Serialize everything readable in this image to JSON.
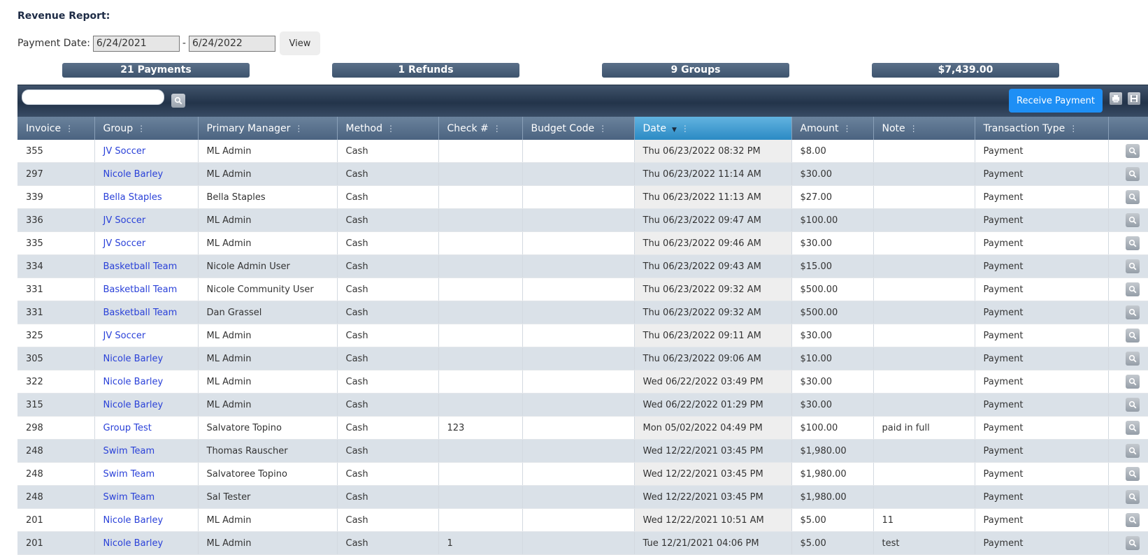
{
  "header": {
    "title": "Revenue Report:",
    "payment_date_label": "Payment Date:",
    "start_date": "6/24/2021",
    "end_date": "6/24/2022",
    "separator": "-",
    "view_label": "View"
  },
  "summary": [
    {
      "label": "21 Payments"
    },
    {
      "label": "1 Refunds"
    },
    {
      "label": "9 Groups"
    },
    {
      "label": "$7,439.00"
    }
  ],
  "toolbar": {
    "search_value": "",
    "receive_payment_label": "Receive Payment",
    "icons": [
      "search-icon",
      "print-icon",
      "save-icon"
    ]
  },
  "table": {
    "sorted_column": "Date",
    "sort_direction": "descending",
    "columns": [
      "Invoice",
      "Group",
      "Primary Manager",
      "Method",
      "Check #",
      "Budget Code",
      "Date",
      "Amount",
      "Note",
      "Transaction Type"
    ],
    "rows": [
      {
        "invoice": "355",
        "group": "JV Soccer",
        "manager": "ML Admin",
        "method": "Cash",
        "check": "",
        "budget": "",
        "date": "Thu 06/23/2022 08:32 PM",
        "amount": "$8.00",
        "note": "",
        "type": "Payment"
      },
      {
        "invoice": "297",
        "group": "Nicole Barley",
        "manager": "ML Admin",
        "method": "Cash",
        "check": "",
        "budget": "",
        "date": "Thu 06/23/2022 11:14 AM",
        "amount": "$30.00",
        "note": "",
        "type": "Payment"
      },
      {
        "invoice": "339",
        "group": "Bella Staples",
        "manager": "Bella Staples",
        "method": "Cash",
        "check": "",
        "budget": "",
        "date": "Thu 06/23/2022 11:13 AM",
        "amount": "$27.00",
        "note": "",
        "type": "Payment"
      },
      {
        "invoice": "336",
        "group": "JV Soccer",
        "manager": "ML Admin",
        "method": "Cash",
        "check": "",
        "budget": "",
        "date": "Thu 06/23/2022 09:47 AM",
        "amount": "$100.00",
        "note": "",
        "type": "Payment"
      },
      {
        "invoice": "335",
        "group": "JV Soccer",
        "manager": "ML Admin",
        "method": "Cash",
        "check": "",
        "budget": "",
        "date": "Thu 06/23/2022 09:46 AM",
        "amount": "$30.00",
        "note": "",
        "type": "Payment"
      },
      {
        "invoice": "334",
        "group": "Basketball Team",
        "manager": "Nicole Admin User",
        "method": "Cash",
        "check": "",
        "budget": "",
        "date": "Thu 06/23/2022 09:43 AM",
        "amount": "$15.00",
        "note": "",
        "type": "Payment"
      },
      {
        "invoice": "331",
        "group": "Basketball Team",
        "manager": "Nicole Community User",
        "method": "Cash",
        "check": "",
        "budget": "",
        "date": "Thu 06/23/2022 09:32 AM",
        "amount": "$500.00",
        "note": "",
        "type": "Payment"
      },
      {
        "invoice": "331",
        "group": "Basketball Team",
        "manager": "Dan Grassel",
        "method": "Cash",
        "check": "",
        "budget": "",
        "date": "Thu 06/23/2022 09:32 AM",
        "amount": "$500.00",
        "note": "",
        "type": "Payment"
      },
      {
        "invoice": "325",
        "group": "JV Soccer",
        "manager": "ML Admin",
        "method": "Cash",
        "check": "",
        "budget": "",
        "date": "Thu 06/23/2022 09:11 AM",
        "amount": "$30.00",
        "note": "",
        "type": "Payment"
      },
      {
        "invoice": "305",
        "group": "Nicole Barley",
        "manager": "ML Admin",
        "method": "Cash",
        "check": "",
        "budget": "",
        "date": "Thu 06/23/2022 09:06 AM",
        "amount": "$10.00",
        "note": "",
        "type": "Payment"
      },
      {
        "invoice": "322",
        "group": "Nicole Barley",
        "manager": "ML Admin",
        "method": "Cash",
        "check": "",
        "budget": "",
        "date": "Wed 06/22/2022 03:49 PM",
        "amount": "$30.00",
        "note": "",
        "type": "Payment"
      },
      {
        "invoice": "315",
        "group": "Nicole Barley",
        "manager": "ML Admin",
        "method": "Cash",
        "check": "",
        "budget": "",
        "date": "Wed 06/22/2022 01:29 PM",
        "amount": "$30.00",
        "note": "",
        "type": "Payment"
      },
      {
        "invoice": "298",
        "group": "Group Test",
        "manager": "Salvatore Topino",
        "method": "Cash",
        "check": "123",
        "budget": "",
        "date": "Mon 05/02/2022 04:49 PM",
        "amount": "$100.00",
        "note": "paid in full",
        "type": "Payment"
      },
      {
        "invoice": "248",
        "group": "Swim Team",
        "manager": "Thomas Rauscher",
        "method": "Cash",
        "check": "",
        "budget": "",
        "date": "Wed 12/22/2021 03:45 PM",
        "amount": "$1,980.00",
        "note": "",
        "type": "Payment"
      },
      {
        "invoice": "248",
        "group": "Swim Team",
        "manager": "Salvatoree Topino",
        "method": "Cash",
        "check": "",
        "budget": "",
        "date": "Wed 12/22/2021 03:45 PM",
        "amount": "$1,980.00",
        "note": "",
        "type": "Payment"
      },
      {
        "invoice": "248",
        "group": "Swim Team",
        "manager": "Sal Tester",
        "method": "Cash",
        "check": "",
        "budget": "",
        "date": "Wed 12/22/2021 03:45 PM",
        "amount": "$1,980.00",
        "note": "",
        "type": "Payment"
      },
      {
        "invoice": "201",
        "group": "Nicole Barley",
        "manager": "ML Admin",
        "method": "Cash",
        "check": "",
        "budget": "",
        "date": "Wed 12/22/2021 10:51 AM",
        "amount": "$5.00",
        "note": "11",
        "type": "Payment"
      },
      {
        "invoice": "201",
        "group": "Nicole Barley",
        "manager": "ML Admin",
        "method": "Cash",
        "check": "1",
        "budget": "",
        "date": "Tue 12/21/2021 04:06 PM",
        "amount": "$5.00",
        "note": "test",
        "type": "Payment"
      }
    ]
  },
  "colors": {
    "header_bg": "#4b6380",
    "sorted_header_bg": "#2b8ac4",
    "link": "#2a41d8",
    "primary_button": "#1e8ff5",
    "row_alt": "#dae1e8"
  }
}
